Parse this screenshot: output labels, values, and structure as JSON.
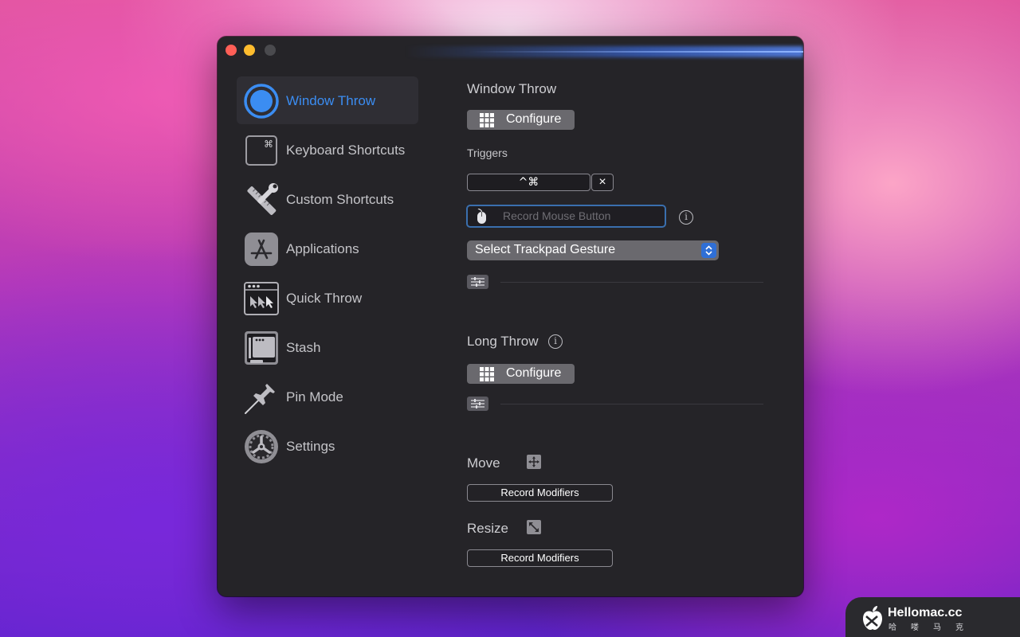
{
  "sidebar": {
    "items": [
      {
        "label": "Window Throw",
        "icon": "window-throw-icon",
        "active": true
      },
      {
        "label": "Keyboard Shortcuts",
        "icon": "command-key-icon"
      },
      {
        "label": "Custom Shortcuts",
        "icon": "tools-icon"
      },
      {
        "label": "Applications",
        "icon": "app-store-icon"
      },
      {
        "label": "Quick Throw",
        "icon": "quick-throw-icon"
      },
      {
        "label": "Stash",
        "icon": "stash-icon"
      },
      {
        "label": "Pin Mode",
        "icon": "pushpin-icon"
      },
      {
        "label": "Settings",
        "icon": "gear-icon"
      }
    ]
  },
  "main": {
    "window_throw": {
      "title": "Window Throw",
      "configure_label": "Configure",
      "triggers_label": "Triggers",
      "shortcut_value": "^⌘",
      "clear_glyph": "×",
      "mouse_placeholder": "Record Mouse Button",
      "gesture_value": "Select Trackpad Gesture"
    },
    "long_throw": {
      "title": "Long Throw",
      "configure_label": "Configure"
    },
    "move": {
      "label": "Move",
      "record_label": "Record Modifiers"
    },
    "resize": {
      "label": "Resize",
      "record_label": "Record Modifiers"
    },
    "info_glyph": "i"
  },
  "watermark": {
    "title": "Hellomac.cc",
    "subtitle": "哈喽马克"
  },
  "colors": {
    "accent": "#3b8df2",
    "window_bg": "#252428",
    "button_bg": "#6a696e"
  }
}
